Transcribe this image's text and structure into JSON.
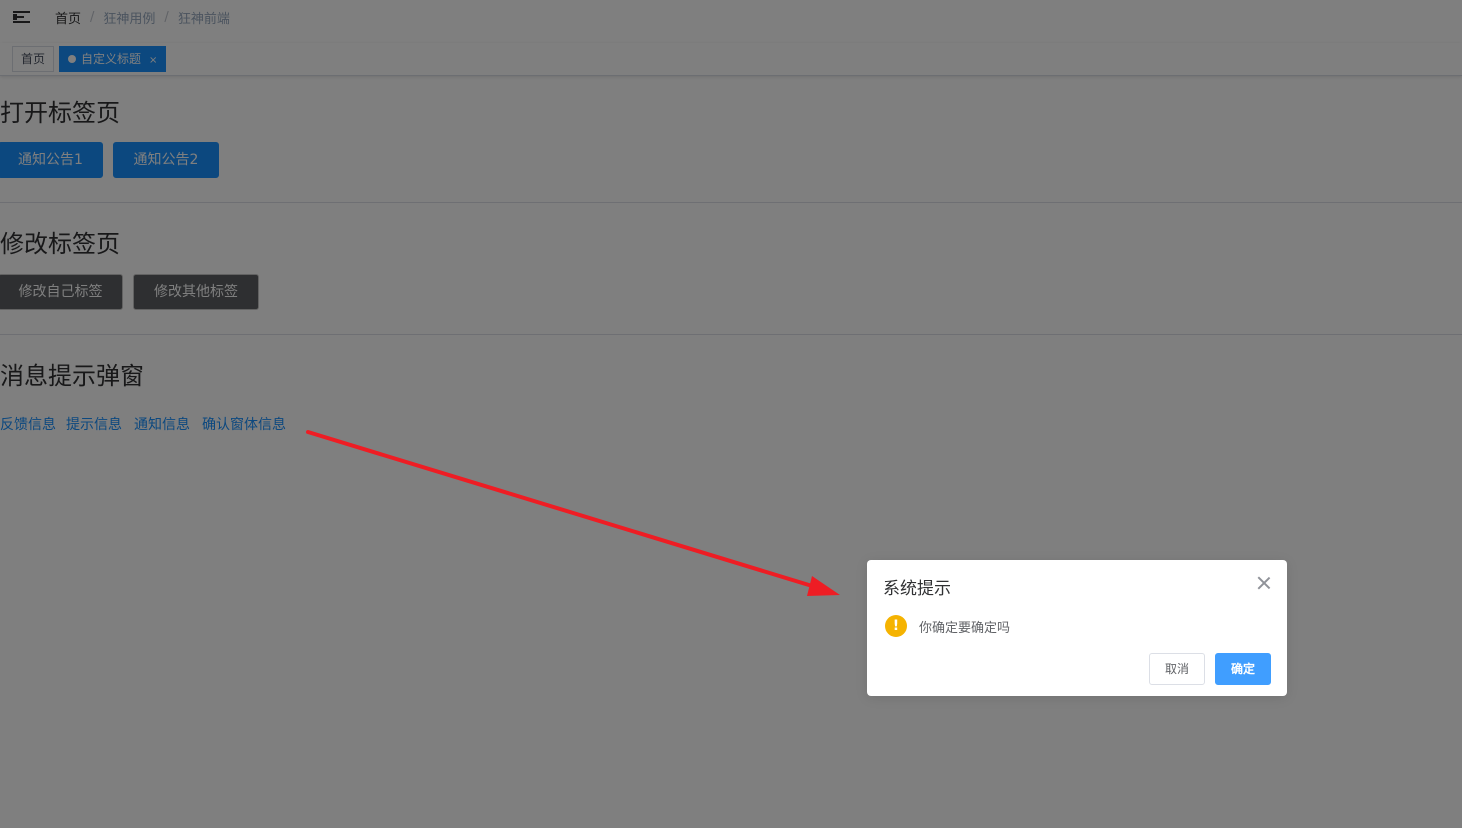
{
  "breadcrumb": [
    "首页",
    "狂神用例",
    "狂神前端"
  ],
  "tags": {
    "home": "首页",
    "active": "自定义标题",
    "active_close": "×"
  },
  "sections": {
    "open_tab": {
      "title": "打开标签页",
      "buttons": [
        "通知公告1",
        "通知公告2"
      ]
    },
    "modify_tab": {
      "title": "修改标签页",
      "buttons": [
        "修改自己标签",
        "修改其他标签"
      ]
    },
    "message_popup": {
      "title": "消息提示弹窗",
      "links": [
        "反馈信息",
        "提示信息",
        "通知信息",
        "确认窗体信息"
      ]
    }
  },
  "dialog": {
    "title": "系统提示",
    "message": "你确定要确定吗",
    "warning_glyph": "!",
    "cancel_label": "取消",
    "confirm_label": "确定"
  },
  "colors": {
    "primary": "#1890ff",
    "confirm": "#409eff",
    "warning": "#f5b301",
    "annotation_arrow": "#ee1d24"
  },
  "icons": {
    "menu": "hamburger-icon",
    "tag_dot": "dot-icon",
    "tag_close": "close-icon",
    "dialog_close": "close-icon",
    "warning": "warning-icon"
  }
}
